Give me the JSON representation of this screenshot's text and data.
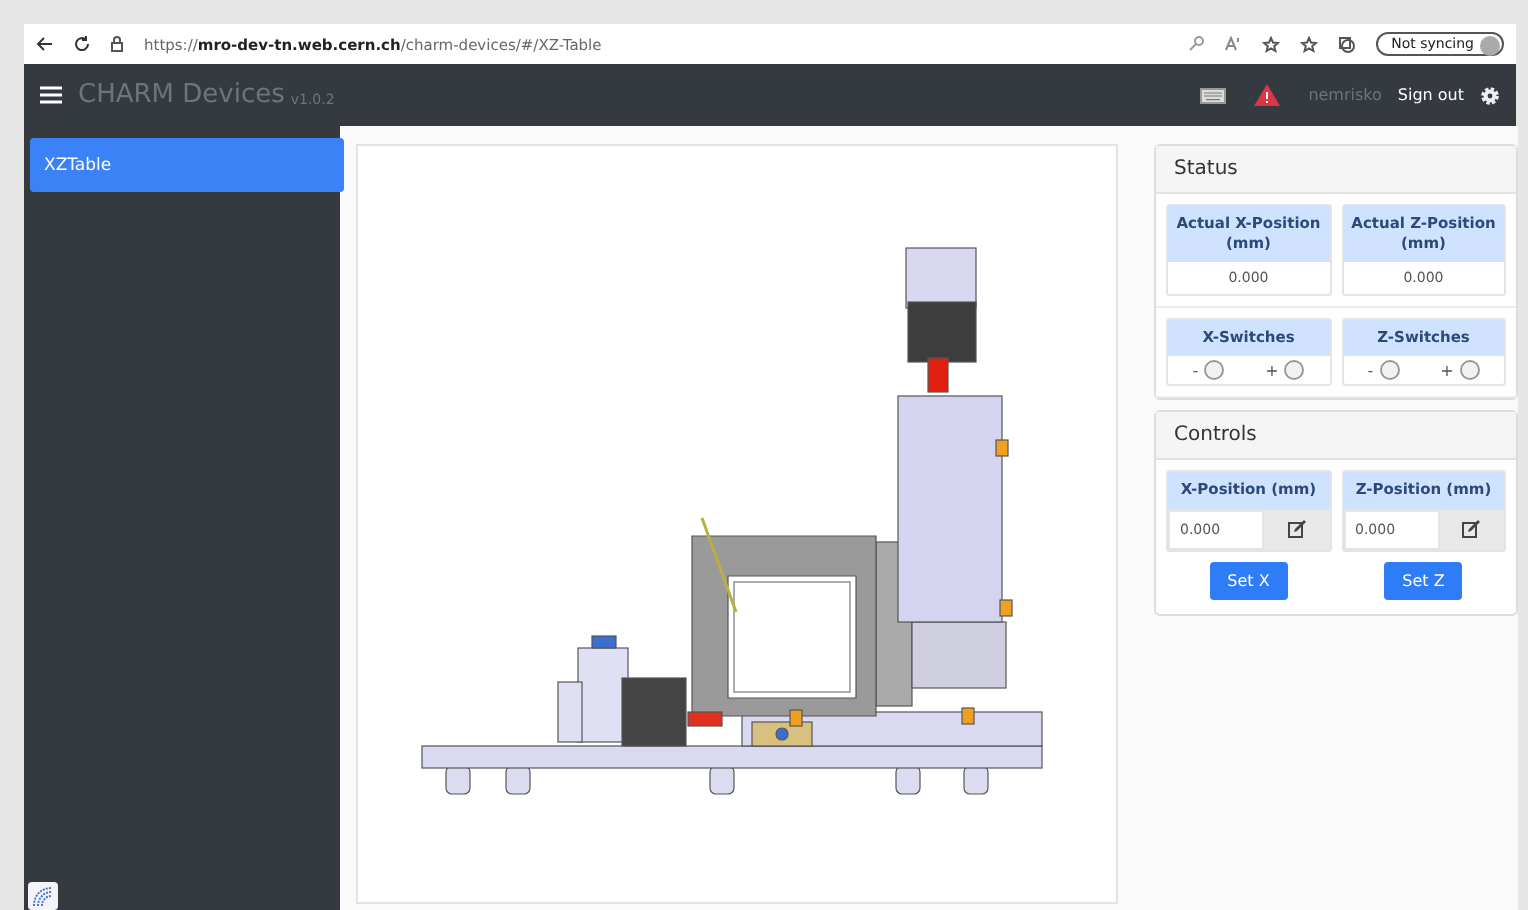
{
  "browser": {
    "url": "https://**mro-dev-tn.web.cern.ch**/charm-devices/#/XZ-Table",
    "sync_label": "Not syncing"
  },
  "navbar": {
    "title": "CHARM Devices",
    "version": "v1.0.2",
    "user": "nemrisko",
    "sign_out": "Sign out"
  },
  "sidebar": {
    "items": [
      {
        "label": "XZTable",
        "selected": true
      }
    ]
  },
  "status": {
    "title": "Status",
    "positions": [
      {
        "label": "Actual X-Position (mm)",
        "value": "0.000"
      },
      {
        "label": "Actual Z-Position (mm)",
        "value": "0.000"
      }
    ],
    "switches": [
      {
        "label": "X-Switches",
        "minus": "-",
        "plus": "+",
        "minus_on": false,
        "plus_on": false
      },
      {
        "label": "Z-Switches",
        "minus": "-",
        "plus": "+",
        "minus_on": false,
        "plus_on": false
      }
    ]
  },
  "controls": {
    "title": "Controls",
    "axes": [
      {
        "label": "X-Position (mm)",
        "value": "0.000",
        "button": "Set X"
      },
      {
        "label": "Z-Position (mm)",
        "value": "0.000",
        "button": "Set Z"
      }
    ]
  }
}
